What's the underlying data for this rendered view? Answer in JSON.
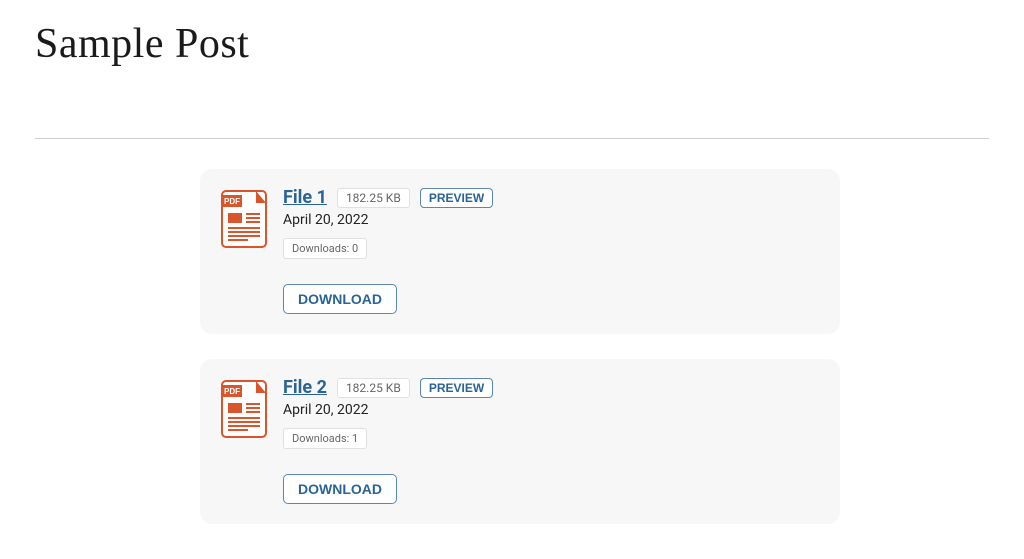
{
  "page": {
    "title": "Sample Post"
  },
  "labels": {
    "preview": "PREVIEW",
    "download": "DOWNLOAD",
    "downloads_prefix": "Downloads: "
  },
  "files": [
    {
      "name": "File 1",
      "size": "182.25 KB",
      "date": "April 20, 2022",
      "downloads": "0",
      "icon": "pdf-icon"
    },
    {
      "name": "File 2",
      "size": "182.25 KB",
      "date": "April 20, 2022",
      "downloads": "1",
      "icon": "pdf-icon"
    }
  ]
}
